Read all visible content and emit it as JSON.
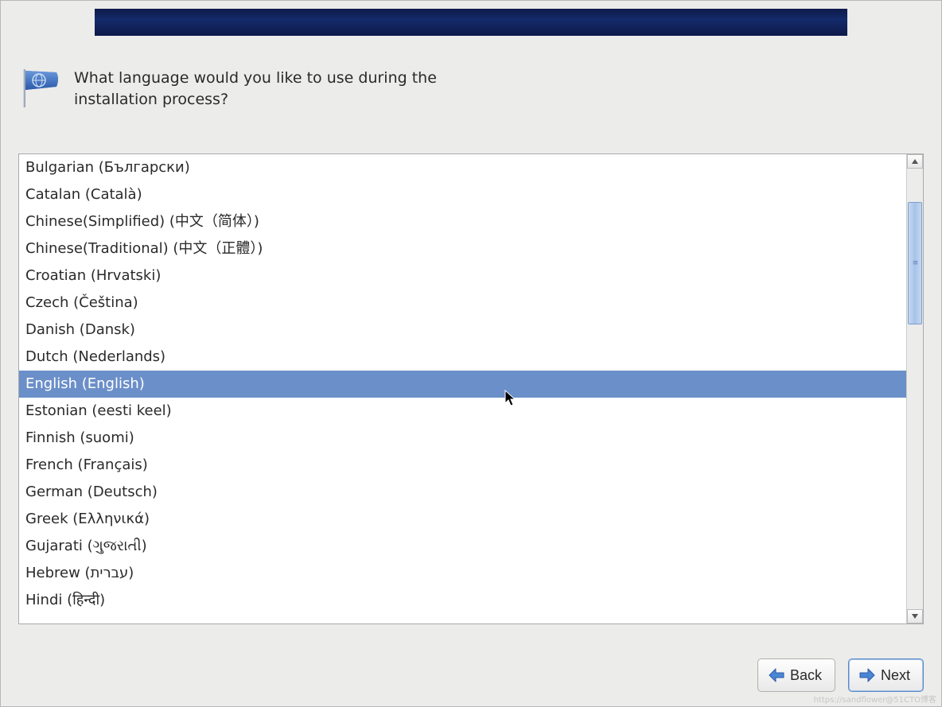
{
  "banner": {
    "title": ""
  },
  "prompt": {
    "text": "What language would you like to use during the installation process?"
  },
  "languages": [
    {
      "label": "Bulgarian (Български)",
      "selected": false
    },
    {
      "label": "Catalan (Català)",
      "selected": false
    },
    {
      "label": "Chinese(Simplified) (中文（简体）)",
      "selected": false
    },
    {
      "label": "Chinese(Traditional) (中文（正體）)",
      "selected": false
    },
    {
      "label": "Croatian (Hrvatski)",
      "selected": false
    },
    {
      "label": "Czech (Čeština)",
      "selected": false
    },
    {
      "label": "Danish (Dansk)",
      "selected": false
    },
    {
      "label": "Dutch (Nederlands)",
      "selected": false
    },
    {
      "label": "English (English)",
      "selected": true
    },
    {
      "label": "Estonian (eesti keel)",
      "selected": false
    },
    {
      "label": "Finnish (suomi)",
      "selected": false
    },
    {
      "label": "French (Français)",
      "selected": false
    },
    {
      "label": "German (Deutsch)",
      "selected": false
    },
    {
      "label": "Greek (Ελληνικά)",
      "selected": false
    },
    {
      "label": "Gujarati (ગુજરાતી)",
      "selected": false
    },
    {
      "label": "Hebrew (עברית)",
      "selected": false
    },
    {
      "label": "Hindi (हिन्दी)",
      "selected": false
    }
  ],
  "buttons": {
    "back": "Back",
    "next": "Next"
  },
  "watermark": "https://sandflower@51CTO博客"
}
